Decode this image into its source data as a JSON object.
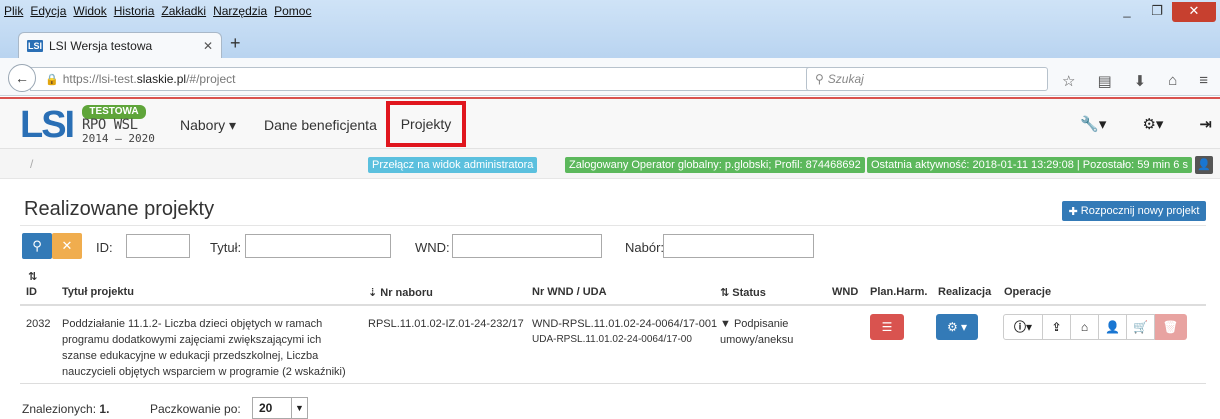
{
  "browser": {
    "menu": [
      "Plik",
      "Edycja",
      "Widok",
      "Historia",
      "Zakładki",
      "Narzędzia",
      "Pomoc"
    ],
    "tab_title": "LSI Wersja testowa",
    "tab_favicon": "LSI",
    "url_prefix": "https://lsi-test.",
    "url_domain": "slaskie.pl",
    "url_suffix": "/#/project",
    "search_placeholder": "Szukaj"
  },
  "app": {
    "logo": {
      "mark": "LSI",
      "badge": "TESTOWA",
      "line1": "RPO WSL",
      "line2": "2014 – 2020"
    },
    "nav": {
      "nabory": "Nabory",
      "dane": "Dane beneficjenta",
      "projekty": "Projekty"
    },
    "breadcrumb": "/",
    "status": {
      "admin_switch": "Przełącz na widok administratora",
      "logged_in": "Zalogowany Operator globalny: p.globski; Profil: 874468692",
      "last_activity": "Ostatnia aktywność: 2018-01-11 13:29:08 | Pozostało: 59 min 6 s"
    }
  },
  "page": {
    "title": "Realizowane projekty",
    "new_project": "Rozpocznij nowy projekt",
    "filters": {
      "id_label": "ID:",
      "title_label": "Tytuł:",
      "wnd_label": "WND:",
      "nabor_label": "Nabór:",
      "id_value": "",
      "title_value": "",
      "wnd_value": "",
      "nabor_value": ""
    },
    "columns": {
      "id": "ID",
      "title": "Tytuł projektu",
      "nr_naboru": "Nr naboru",
      "nr_wnd": "Nr WND / UDA",
      "status": "Status",
      "wnd": "WND",
      "plan": "Plan.Harm.",
      "realizacja": "Realizacja",
      "operacje": "Operacje"
    },
    "rows": [
      {
        "id": "2032",
        "title_lines": [
          "Poddziałanie 11.1.2- Liczba dzieci objętych w ramach",
          "programu dodatkowymi zajęciami zwiększającymi ich",
          "szanse edukacyjne w edukacji przedszkolnej, Liczba",
          "nauczycieli objętych wsparciem w programie (2 wskaźniki)"
        ],
        "nr_naboru": "RPSL.11.01.02-IZ.01-24-232/17",
        "nr_wnd": "WND-RPSL.11.01.02-24-0064/17-001",
        "nr_uda": "UDA-RPSL.11.01.02-24-0064/17-00",
        "status_line1": "Podpisanie",
        "status_line2": "umowy/aneksu"
      }
    ],
    "footer": {
      "found_label": "Znalezionych:",
      "found_count": "1.",
      "page_size_label": "Paczkowanie po:",
      "page_size": "20"
    }
  }
}
